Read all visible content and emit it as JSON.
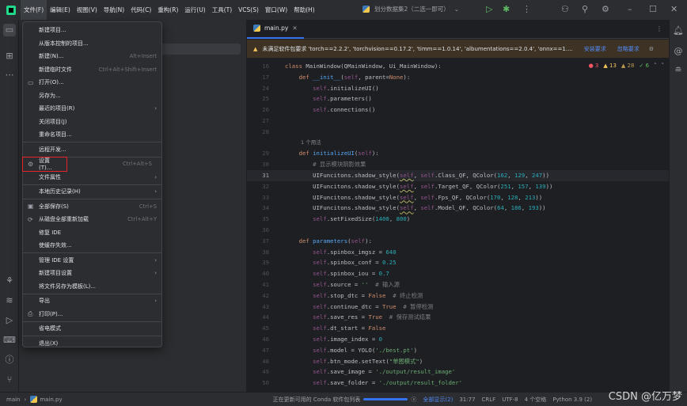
{
  "menubar": [
    "文件(F)",
    "编辑(E)",
    "视图(V)",
    "导航(N)",
    "代码(C)",
    "重构(R)",
    "运行(U)",
    "工具(T)",
    "VCS(S)",
    "窗口(W)",
    "帮助(H)"
  ],
  "run_config": "划分数据集2（二选一即可）",
  "tab": "main.py",
  "banner": {
    "text": "未满足软件包要求 'torch==2.2.2', 'torchvision==0.17.2', 'timm==1.0.14', 'albumentations==2.0.4', 'onnx==1....",
    "install": "安装要求",
    "ignore": "忽略要求"
  },
  "inspections": {
    "errors": "3",
    "warnings": "13",
    "weak": "28",
    "ok": "6"
  },
  "file_menu": [
    {
      "label": "新建项目..."
    },
    {
      "label": "从版本控制的项目..."
    },
    {
      "label": "新建(N)...",
      "shortcut": "Alt+Insert"
    },
    {
      "label": "新建临时文件",
      "shortcut": "Ctrl+Alt+Shift+Insert"
    },
    {
      "label": "打开(O)...",
      "icon": "folder"
    },
    {
      "label": "另存为..."
    },
    {
      "label": "最近的项目(R)",
      "sub": true
    },
    {
      "label": "关闭项目(J)"
    },
    {
      "label": "重命名项目..."
    },
    {
      "sep": true
    },
    {
      "label": "远程开发..."
    },
    {
      "sep": true
    },
    {
      "label": "设置(T)...",
      "shortcut": "Ctrl+Alt+S",
      "icon": "gear",
      "highlight": true
    },
    {
      "label": "文件属性",
      "sub": true
    },
    {
      "sep": true
    },
    {
      "label": "本地历史记录(H)",
      "sub": true
    },
    {
      "sep": true
    },
    {
      "label": "全部保存(S)",
      "shortcut": "Ctrl+S",
      "icon": "save"
    },
    {
      "label": "从磁盘全部重新加载",
      "shortcut": "Ctrl+Alt+Y",
      "icon": "reload"
    },
    {
      "label": "修复 IDE"
    },
    {
      "label": "使缓存失效..."
    },
    {
      "sep": true
    },
    {
      "label": "管理 IDE 设置",
      "sub": true
    },
    {
      "label": "新建项目设置",
      "sub": true
    },
    {
      "label": "将文件另存为模板(L)..."
    },
    {
      "sep": true
    },
    {
      "label": "导出",
      "sub": true
    },
    {
      "label": "打印(P)...",
      "icon": "print"
    },
    {
      "sep": true
    },
    {
      "label": "省电模式"
    },
    {
      "sep": true
    },
    {
      "label": "退出(X)"
    }
  ],
  "code": [
    {
      "n": "16",
      "t": [
        [
          "class ",
          "kw"
        ],
        [
          "MainWindow(QMainWindow, Ui_MainWindow):",
          "pl"
        ]
      ]
    },
    {
      "n": "17",
      "t": [
        [
          "    def ",
          "kw"
        ],
        [
          "__init__",
          "fn"
        ],
        [
          "(",
          "pl"
        ],
        [
          "self",
          "sf"
        ],
        [
          ", parent=",
          "pl"
        ],
        [
          "None",
          "kw"
        ],
        [
          "):",
          "pl"
        ]
      ]
    },
    {
      "n": "24",
      "t": [
        [
          "        self",
          "sf"
        ],
        [
          ".initializeUI()",
          "pl"
        ]
      ]
    },
    {
      "n": "25",
      "t": [
        [
          "        self",
          "sf"
        ],
        [
          ".parameters()",
          "pl"
        ]
      ]
    },
    {
      "n": "26",
      "t": [
        [
          "        self",
          "sf"
        ],
        [
          ".connections()",
          "pl"
        ]
      ]
    },
    {
      "n": "27",
      "t": []
    },
    {
      "n": "28",
      "t": []
    },
    {
      "n": "",
      "hint": "1 个用法"
    },
    {
      "n": "29",
      "t": [
        [
          "    def ",
          "kw"
        ],
        [
          "initializeUI",
          "fn"
        ],
        [
          "(",
          "pl"
        ],
        [
          "self",
          "sf"
        ],
        [
          "):",
          "pl"
        ]
      ]
    },
    {
      "n": "30",
      "t": [
        [
          "        # 显示模块阴影效果",
          "cm"
        ]
      ]
    },
    {
      "n": "31",
      "cur": true,
      "t": [
        [
          "        UIFuncitons.shadow_style(",
          "pl"
        ],
        [
          "self",
          "sf und"
        ],
        [
          ", ",
          "pl"
        ],
        [
          "self",
          "sf"
        ],
        [
          ".Class_QF, QColor(",
          "pl"
        ],
        [
          "162",
          "num"
        ],
        [
          ", ",
          "pl"
        ],
        [
          "129",
          "num"
        ],
        [
          ", ",
          "pl"
        ],
        [
          "247",
          "num"
        ],
        [
          "))",
          "pl"
        ]
      ]
    },
    {
      "n": "32",
      "t": [
        [
          "        UIFuncitons.shadow_style(",
          "pl"
        ],
        [
          "self",
          "sf und"
        ],
        [
          ", ",
          "pl"
        ],
        [
          "self",
          "sf"
        ],
        [
          ".Target_QF, QColor(",
          "pl"
        ],
        [
          "251",
          "num"
        ],
        [
          ", ",
          "pl"
        ],
        [
          "157",
          "num"
        ],
        [
          ", ",
          "pl"
        ],
        [
          "139",
          "num"
        ],
        [
          "))",
          "pl"
        ]
      ]
    },
    {
      "n": "33",
      "t": [
        [
          "        UIFuncitons.shadow_style(",
          "pl"
        ],
        [
          "self",
          "sf und"
        ],
        [
          ", ",
          "pl"
        ],
        [
          "self",
          "sf"
        ],
        [
          ".Fps_QF, QColor(",
          "pl"
        ],
        [
          "170",
          "num"
        ],
        [
          ", ",
          "pl"
        ],
        [
          "128",
          "num"
        ],
        [
          ", ",
          "pl"
        ],
        [
          "213",
          "num"
        ],
        [
          "))",
          "pl"
        ]
      ]
    },
    {
      "n": "34",
      "t": [
        [
          "        UIFuncitons.shadow_style(",
          "pl"
        ],
        [
          "self",
          "sf und"
        ],
        [
          ", ",
          "pl"
        ],
        [
          "self",
          "sf"
        ],
        [
          ".Model_QF, QColor(",
          "pl"
        ],
        [
          "64",
          "num"
        ],
        [
          ", ",
          "pl"
        ],
        [
          "186",
          "num"
        ],
        [
          ", ",
          "pl"
        ],
        [
          "193",
          "num"
        ],
        [
          "))",
          "pl"
        ]
      ]
    },
    {
      "n": "35",
      "t": [
        [
          "        self",
          "sf"
        ],
        [
          ".setFixedSize(",
          "pl"
        ],
        [
          "1400",
          "num"
        ],
        [
          ", ",
          "pl"
        ],
        [
          "800",
          "num"
        ],
        [
          ")",
          "pl"
        ]
      ]
    },
    {
      "n": "36",
      "t": []
    },
    {
      "n": "37",
      "t": [
        [
          "    def ",
          "kw"
        ],
        [
          "parameters",
          "fn"
        ],
        [
          "(",
          "pl"
        ],
        [
          "self",
          "sf"
        ],
        [
          "):",
          "pl"
        ]
      ]
    },
    {
      "n": "38",
      "t": [
        [
          "        self",
          "sf"
        ],
        [
          ".spinbox_imgsz = ",
          "pl"
        ],
        [
          "640",
          "num"
        ]
      ]
    },
    {
      "n": "39",
      "t": [
        [
          "        self",
          "sf"
        ],
        [
          ".spinbox_conf = ",
          "pl"
        ],
        [
          "0.25",
          "num"
        ]
      ]
    },
    {
      "n": "40",
      "t": [
        [
          "        self",
          "sf"
        ],
        [
          ".spinbox_iou = ",
          "pl"
        ],
        [
          "0.7",
          "num"
        ]
      ]
    },
    {
      "n": "41",
      "t": [
        [
          "        self",
          "sf"
        ],
        [
          ".source = ",
          "pl"
        ],
        [
          "''",
          "str"
        ],
        [
          "  # 输入源",
          "cm"
        ]
      ]
    },
    {
      "n": "42",
      "t": [
        [
          "        self",
          "sf"
        ],
        [
          ".stop_dtc = ",
          "pl"
        ],
        [
          "False",
          "kw"
        ],
        [
          "  # 终止检测",
          "cm"
        ]
      ]
    },
    {
      "n": "43",
      "t": [
        [
          "        self",
          "sf"
        ],
        [
          ".continue_dtc = ",
          "pl"
        ],
        [
          "True",
          "kw"
        ],
        [
          "  # 暂停检测",
          "cm"
        ]
      ]
    },
    {
      "n": "44",
      "t": [
        [
          "        self",
          "sf"
        ],
        [
          ".save_res = ",
          "pl"
        ],
        [
          "True",
          "kw"
        ],
        [
          "  # 保存测试结果",
          "cm"
        ]
      ]
    },
    {
      "n": "45",
      "t": [
        [
          "        self",
          "sf"
        ],
        [
          ".dt_start = ",
          "pl"
        ],
        [
          "False",
          "kw"
        ]
      ]
    },
    {
      "n": "46",
      "t": [
        [
          "        self",
          "sf"
        ],
        [
          ".image_index = ",
          "pl"
        ],
        [
          "0",
          "num"
        ]
      ]
    },
    {
      "n": "47",
      "t": [
        [
          "        self",
          "sf"
        ],
        [
          ".model = YOLO(",
          "pl"
        ],
        [
          "'./best.pt'",
          "str"
        ],
        [
          ")",
          "pl"
        ]
      ]
    },
    {
      "n": "48",
      "t": [
        [
          "        self",
          "sf"
        ],
        [
          ".btn_mode.setText(",
          "pl"
        ],
        [
          "\"单图模式\"",
          "str"
        ],
        [
          ")",
          "pl"
        ]
      ]
    },
    {
      "n": "49",
      "t": [
        [
          "        self",
          "sf"
        ],
        [
          ".save_image = ",
          "pl"
        ],
        [
          "'./output/result_image'",
          "str"
        ]
      ]
    },
    {
      "n": "50",
      "t": [
        [
          "        self",
          "sf"
        ],
        [
          ".save_folder = ",
          "pl"
        ],
        [
          "'./output/result_folder'",
          "str"
        ]
      ]
    }
  ],
  "status": {
    "branch": "main",
    "file": "main.py",
    "task": "正在更新可用的 Conda 软件包列表",
    "progress": 0.8,
    "show_all": "全部显示(2)",
    "pos": "31:77",
    "eol": "CRLF",
    "enc": "UTF-8",
    "indent": "4 个空格",
    "interp": "Python 3.9 (2)"
  },
  "watermark": "CSDN @亿万梦"
}
